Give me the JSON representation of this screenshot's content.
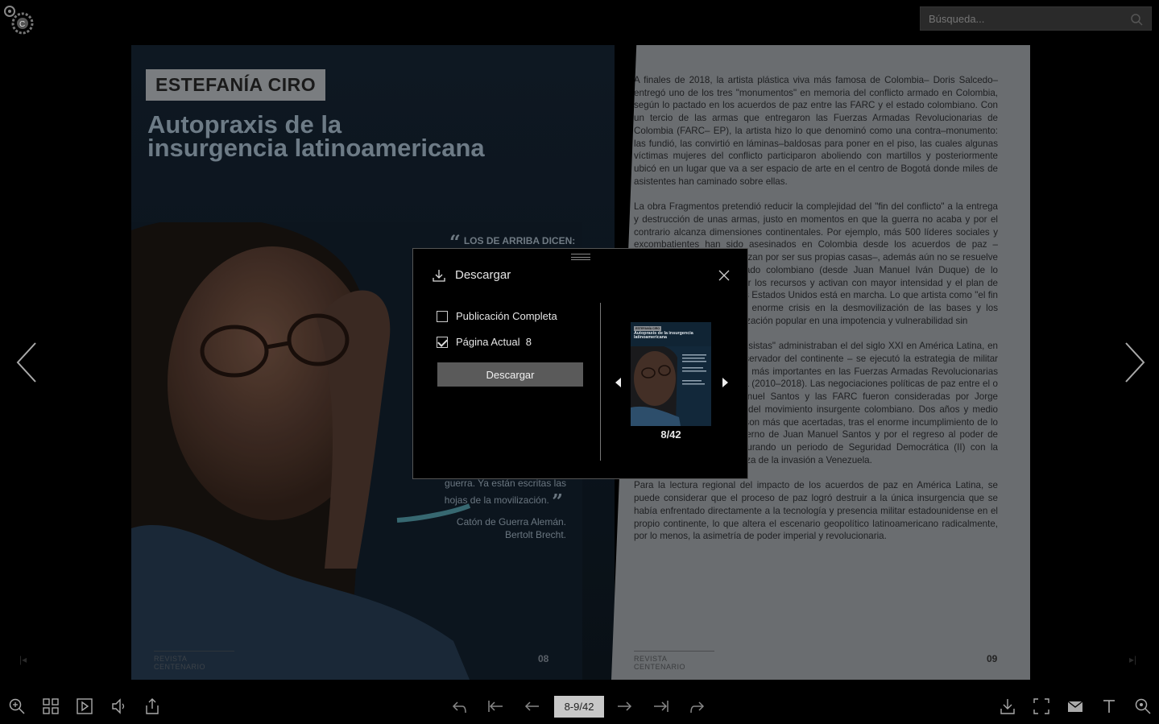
{
  "search": {
    "placeholder": "Búsqueda..."
  },
  "left_page": {
    "author": "ESTEFANÍA CIRO",
    "title": "Autopraxis de la insurgencia latinoamericana",
    "quote_head": "LOS DE ARRIBA DICEN:",
    "quote_tail_1": "guerra. Ya están escritas las",
    "quote_tail_2": "hojas de la movilización.",
    "quote_author_1": "Catón de Guerra Alemán.",
    "quote_author_2": "Bertolt Brecht.",
    "running_head": "REVISTA CENTENARIO",
    "folio": "08"
  },
  "right_page": {
    "running_head": "REVISTA CENTENARIO",
    "folio": "09",
    "paragraphs": [
      "A finales de 2018, la artista plástica viva más famosa de Colombia– Doris Salcedo– entregó uno de los tres \"monumentos\" en memoria del conflicto armado en Colombia, según lo pactado en los acuerdos de paz entre las FARC y el estado colombiano. Con un tercio de las armas que entregaron las Fuerzas Armadas Revolucionarias de Colombia (FARC– EP), la artista hizo lo que denominó como una contra–monumento: las fundió, las convirtió en láminas–baldosas para poner en el piso, las cuales algunas víctimas mujeres del conflicto participaron aboliendo con martillos y posteriormente ubicó en un lugar que va a ser espacio de arte en el centro de Bogotá donde miles de asistentes han caminado sobre ellas.",
      "La obra Fragmentos pretendió reducir la complejidad del \"fin del conflicto\" a la entrega y destrucción de unas armas, justo en momentos en que la guerra no acaba y por el contrario alcanza dimensiones continentales. Por ejemplo, más 500 líderes sociales y excombatientes han sido asesinados en Colombia desde los acuerdos de paz – asesinatos que se caracterizan por ser sus propias casas–, además aún no se resuelve el incumplimiento del estado colombiano (desde Juan Manuel Iván Duque) de lo acordado, los conflictos por los recursos y activan con mayor intensidad y el plan de intervención en parte de los Estados Unidos está en marcha. Lo que artista como \"el fin del conflicto\" es solo una enorme crisis en la desmovilización de las bases y los mandos medios, y la movilización popular en una impotencia y vulnerabilidad sin",
      "mientras los países \"progresistas\" administraban el del siglo XXI en América Latina, en Colombia– el eslabón conservador del continente – se ejecutó la estrategia de militar de una de las insurgencias más importantes en las Fuerzas Armadas Revolucionarias de Colombia (FARC), el día (2010–2018). Las negociaciones políticas de paz entre el o a la cabeza de Juan Manuel Santos y las FARC fueron consideradas por Jorge Beinstein como la derrota del movimiento insurgente colombiano. Dos años y medio después, sus palabras no son más que acertadas, tras el enorme incumplimiento de lo firmado por parte del gobierno de Juan Manuel Santos y por el regreso al poder de Álvaro Uribe Vélez, inaugurando un periodo de Seguridad Democrática (II) con la puesta en escena y amenaza de la invasión a Venezuela.",
      "Para la lectura regional del impacto de los acuerdos de paz en América Latina, se puede considerar que el proceso de paz logró destruir a la única insurgencia que se había enfrentado directamente a la tecnología y presencia militar estadounidense en el propio continente, lo que altera el escenario geopolítico latinoamericano radicalmente, por lo menos, la asimetría de poder imperial y revolucionaria."
    ]
  },
  "modal": {
    "title": "Descargar",
    "option_full": "Publicación Completa",
    "option_current": "Página Actual",
    "option_current_page": "8",
    "option_full_checked": false,
    "option_current_checked": true,
    "button_label": "Descargar",
    "thumb_author": "ESTEFANÍA CIRO",
    "thumb_title": "Autopraxis de la insurgencia latinoamericana",
    "thumb_label": "8/42"
  },
  "toolbar": {
    "page_indicator": "8-9/42",
    "left_icons": [
      "zoom-in-icon",
      "thumbnails-icon",
      "autoplay-icon",
      "sound-icon",
      "share-icon"
    ],
    "center_icons": [
      "back-icon",
      "first-page-icon",
      "previous-page-icon",
      "next-page-icon",
      "last-page-icon",
      "forward-icon"
    ],
    "right_icons": [
      "download-icon",
      "fullscreen-icon",
      "email-icon",
      "text-icon",
      "search-icon"
    ]
  },
  "colors": {
    "background": "#000000",
    "page_dark": "#0f1a24",
    "page_light": "#6a6d70",
    "button": "#5a5a5a",
    "indicator": "#c8c8c8"
  }
}
